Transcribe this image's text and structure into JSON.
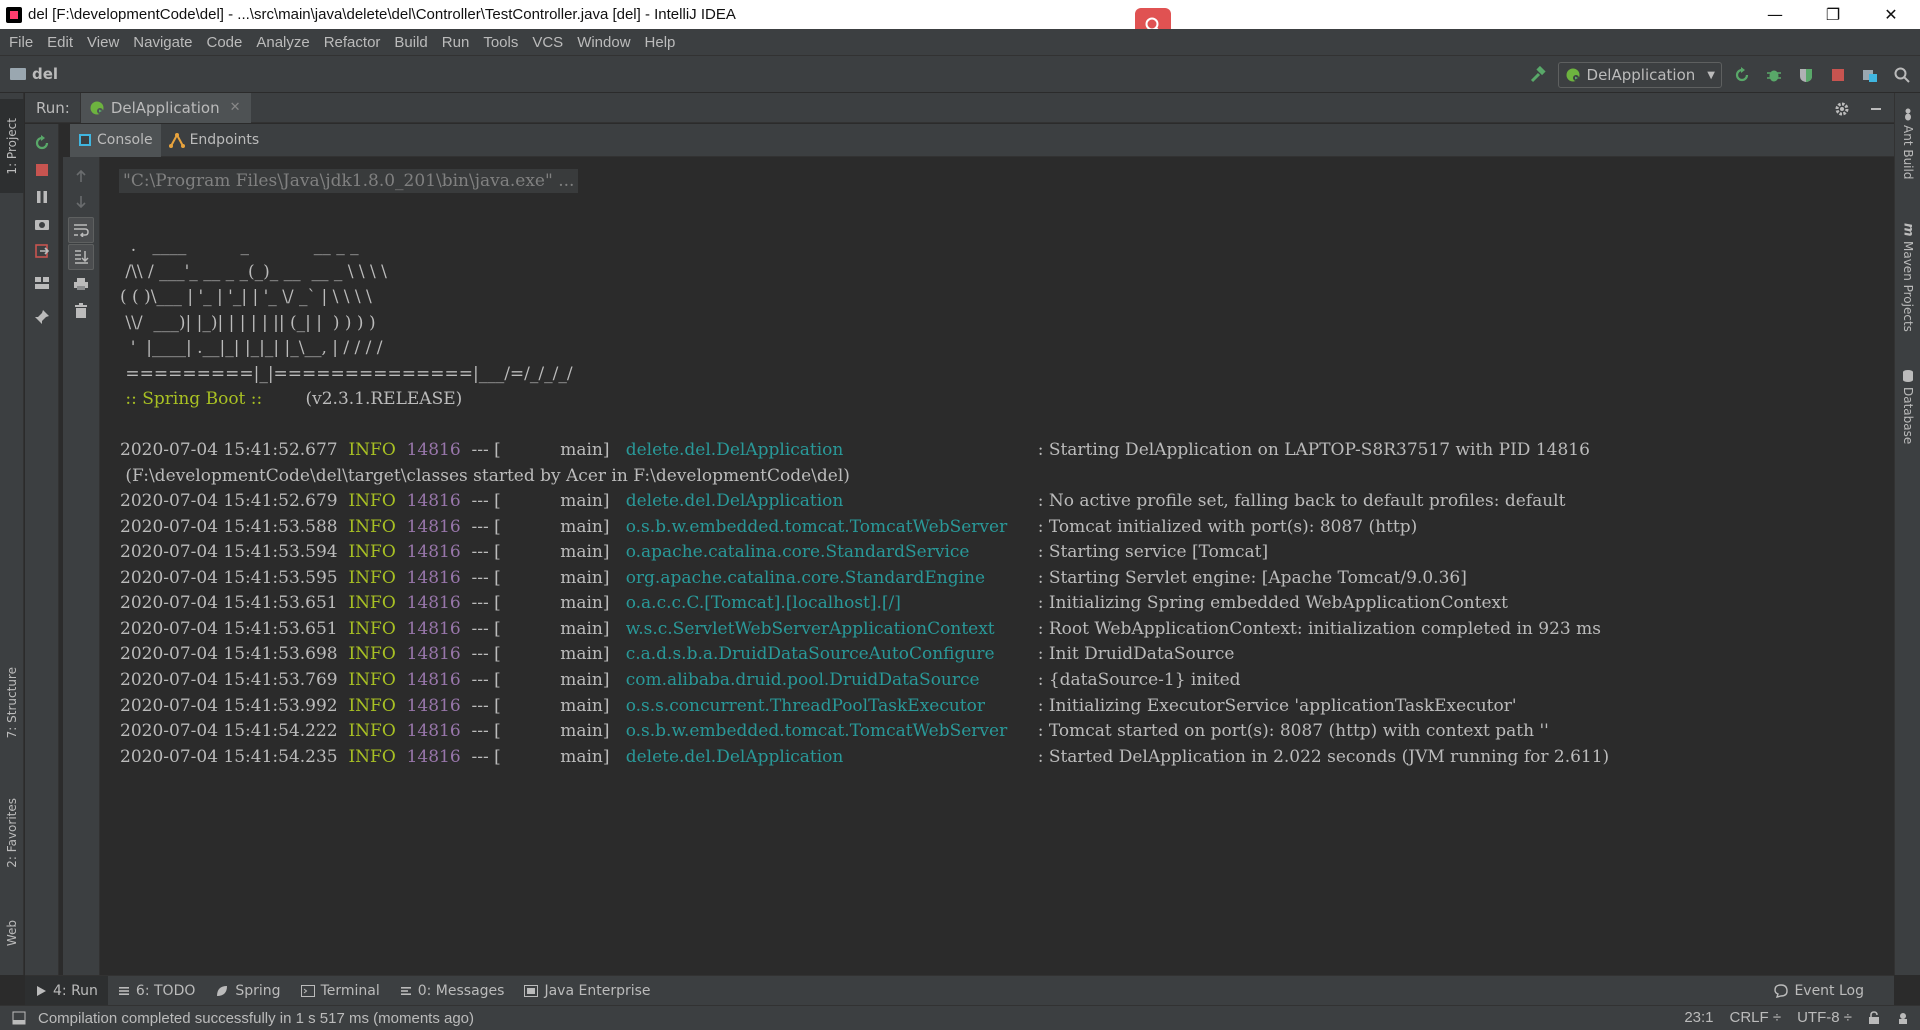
{
  "window": {
    "title": "del [F:\\developmentCode\\del] - ...\\src\\main\\java\\delete\\del\\Controller\\TestController.java [del] - IntelliJ IDEA",
    "controls": {
      "minimize": "—",
      "maximize": "❐",
      "close": "✕"
    }
  },
  "menu": [
    "File",
    "Edit",
    "View",
    "Navigate",
    "Code",
    "Analyze",
    "Refactor",
    "Build",
    "Run",
    "Tools",
    "VCS",
    "Window",
    "Help"
  ],
  "navbar": {
    "project": "del",
    "run_config": "DelApplication"
  },
  "left_stripe": {
    "project": "1: Project",
    "structure": "7: Structure",
    "favorites": "2: Favorites",
    "web": "Web"
  },
  "right_stripe": {
    "ant": "Ant Build",
    "maven": "Maven Projects",
    "database": "Database"
  },
  "run_window": {
    "label": "Run:",
    "tab": "DelApplication",
    "subtabs": {
      "console": "Console",
      "endpoints": "Endpoints"
    }
  },
  "console": {
    "command": "\"C:\\Program Files\\Java\\jdk1.8.0_201\\bin\\java.exe\" ...",
    "banner": [
      "  .   ____          _            __ _ _",
      " /\\\\ / ___'_ __ _ _(_)_ __  __ _ \\ \\ \\ \\",
      "( ( )\\___ | '_ | '_| | '_ \\/ _` | \\ \\ \\ \\",
      " \\\\/  ___)| |_)| | | | | || (_| |  ) ) ) )",
      "  '  |____| .__|_| |_|_| |_\\__, | / / / /",
      " =========|_|==============|___/=/_/_/_/"
    ],
    "boot_label": " :: Spring Boot :: ",
    "boot_version": "       (v2.3.1.RELEASE)",
    "logs": [
      {
        "ts": "2020-07-04 15:41:52.677",
        "level": "INFO",
        "pid": "14816",
        "thread": "--- [           main] ",
        "logger": "delete.del.DelApplication",
        "msg": ": Starting DelApplication on LAPTOP-S8R37517 with PID 14816"
      },
      {
        "cont": " (F:\\developmentCode\\del\\target\\classes started by Acer in F:\\developmentCode\\del)"
      },
      {
        "ts": "2020-07-04 15:41:52.679",
        "level": "INFO",
        "pid": "14816",
        "thread": "--- [           main] ",
        "logger": "delete.del.DelApplication",
        "msg": ": No active profile set, falling back to default profiles: default"
      },
      {
        "ts": "2020-07-04 15:41:53.588",
        "level": "INFO",
        "pid": "14816",
        "thread": "--- [           main] ",
        "logger": "o.s.b.w.embedded.tomcat.TomcatWebServer",
        "msg": ": Tomcat initialized with port(s): 8087 (http)"
      },
      {
        "ts": "2020-07-04 15:41:53.594",
        "level": "INFO",
        "pid": "14816",
        "thread": "--- [           main] ",
        "logger": "o.apache.catalina.core.StandardService",
        "msg": ": Starting service [Tomcat]"
      },
      {
        "ts": "2020-07-04 15:41:53.595",
        "level": "INFO",
        "pid": "14816",
        "thread": "--- [           main] ",
        "logger": "org.apache.catalina.core.StandardEngine",
        "msg": ": Starting Servlet engine: [Apache Tomcat/9.0.36]"
      },
      {
        "ts": "2020-07-04 15:41:53.651",
        "level": "INFO",
        "pid": "14816",
        "thread": "--- [           main] ",
        "logger": "o.a.c.c.C.[Tomcat].[localhost].[/]",
        "msg": ": Initializing Spring embedded WebApplicationContext"
      },
      {
        "ts": "2020-07-04 15:41:53.651",
        "level": "INFO",
        "pid": "14816",
        "thread": "--- [           main] ",
        "logger": "w.s.c.ServletWebServerApplicationContext",
        "msg": ": Root WebApplicationContext: initialization completed in 923 ms"
      },
      {
        "ts": "2020-07-04 15:41:53.698",
        "level": "INFO",
        "pid": "14816",
        "thread": "--- [           main] ",
        "logger": "c.a.d.s.b.a.DruidDataSourceAutoConfigure",
        "msg": ": Init DruidDataSource"
      },
      {
        "ts": "2020-07-04 15:41:53.769",
        "level": "INFO",
        "pid": "14816",
        "thread": "--- [           main] ",
        "logger": "com.alibaba.druid.pool.DruidDataSource",
        "msg": ": {dataSource-1} inited"
      },
      {
        "ts": "2020-07-04 15:41:53.992",
        "level": "INFO",
        "pid": "14816",
        "thread": "--- [           main] ",
        "logger": "o.s.s.concurrent.ThreadPoolTaskExecutor",
        "msg": ": Initializing ExecutorService 'applicationTaskExecutor'"
      },
      {
        "ts": "2020-07-04 15:41:54.222",
        "level": "INFO",
        "pid": "14816",
        "thread": "--- [           main] ",
        "logger": "o.s.b.w.embedded.tomcat.TomcatWebServer",
        "msg": ": Tomcat started on port(s): 8087 (http) with context path ''"
      },
      {
        "ts": "2020-07-04 15:41:54.235",
        "level": "INFO",
        "pid": "14816",
        "thread": "--- [           main] ",
        "logger": "delete.del.DelApplication",
        "msg": ": Started DelApplication in 2.022 seconds (JVM running for 2.611)"
      }
    ]
  },
  "bottom_tabs": {
    "run": "4: Run",
    "todo": "6: TODO",
    "spring": "Spring",
    "terminal": "Terminal",
    "messages": "0: Messages",
    "java_enterprise": "Java Enterprise",
    "event_log": "Event Log"
  },
  "status": {
    "message": "Compilation completed successfully in 1 s 517 ms (moments ago)",
    "position": "23:1",
    "line_sep": "CRLF ÷",
    "encoding": "UTF-8 ÷"
  },
  "colors": {
    "info": "#a8c023",
    "pid": "#9876aa",
    "logger": "#299999",
    "background": "#2b2b2b",
    "panel": "#3c3f41"
  }
}
